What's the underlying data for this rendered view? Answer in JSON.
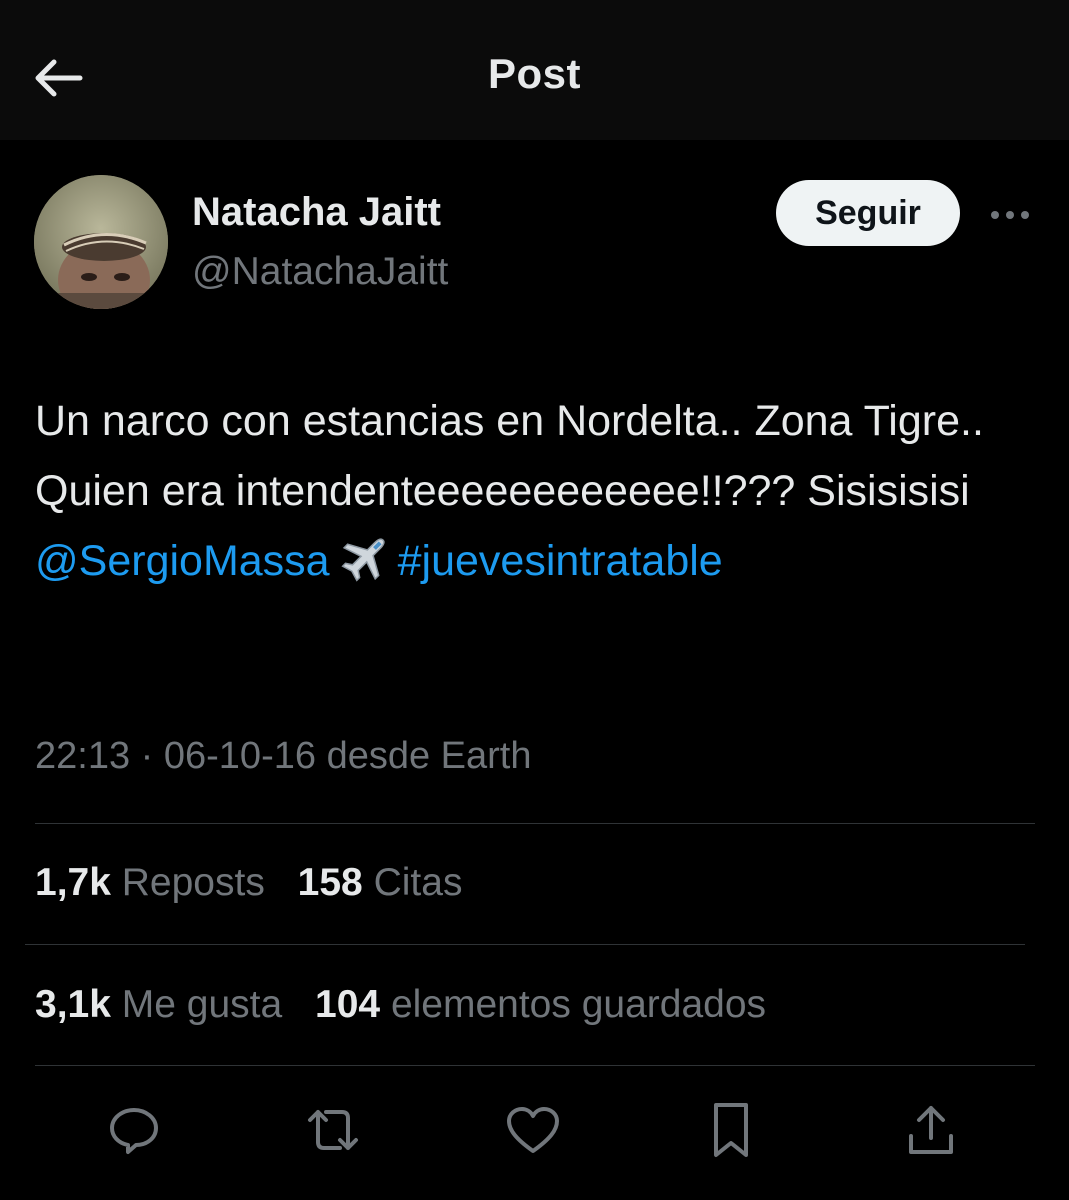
{
  "header": {
    "title": "Post",
    "back_icon": "arrow-left-icon"
  },
  "author": {
    "name": "Natacha Jaitt",
    "handle": "@NatachaJaitt",
    "follow_label": "Seguir",
    "more_icon": "more-horizontal-icon"
  },
  "tweet": {
    "text_plain": "Un narco con estancias en Nordelta.. Zona Tigre.. Quien era intendenteeeeeeeeeeee!!??? Sisisisisi",
    "mention": "@SergioMassa",
    "emoji_icon": "airplane-icon",
    "hashtag": "#juevesintratable"
  },
  "meta": {
    "time": "22:13",
    "separator": "·",
    "date": "06-10-16",
    "source": "desde Earth"
  },
  "stats": {
    "reposts_count": "1,7k",
    "reposts_label": "Reposts",
    "quotes_count": "158",
    "quotes_label": "Citas",
    "likes_count": "3,1k",
    "likes_label": "Me gusta",
    "bookmarks_count": "104",
    "bookmarks_label": "elementos guardados"
  },
  "actions": [
    "reply-icon",
    "repost-icon",
    "like-icon",
    "bookmark-icon",
    "share-icon"
  ],
  "colors": {
    "background": "#000000",
    "topbar": "#0b0b0b",
    "text": "#e7e9ea",
    "secondary": "#71767b",
    "link": "#1d9bf0",
    "divider": "#2f3336",
    "follow_bg": "#eff3f4"
  }
}
